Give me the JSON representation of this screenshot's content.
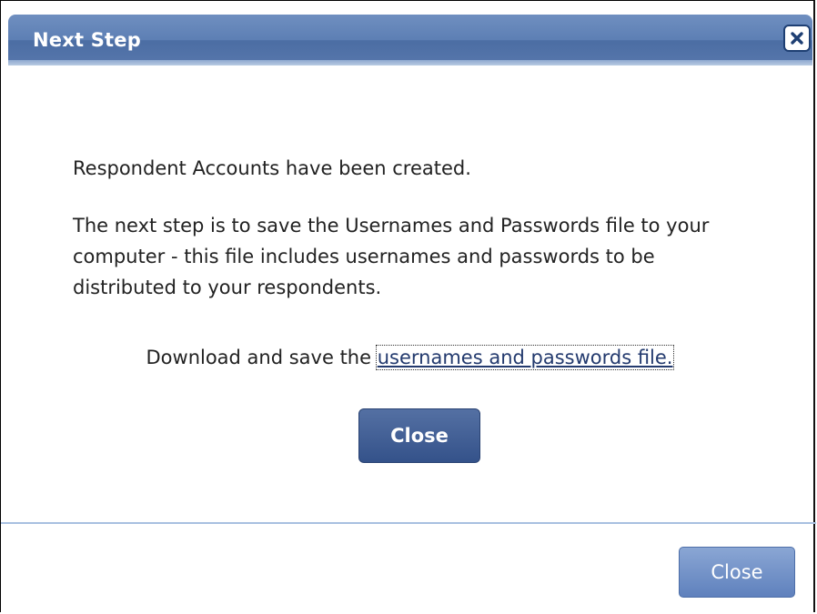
{
  "dialog": {
    "title": "Next Step",
    "close_icon": "close-x-icon"
  },
  "body": {
    "line1": "Respondent Accounts have been created.",
    "line2": "The next step is to save the Usernames and Passwords file to your computer - this file includes usernames and passwords to be distributed to your respondents.",
    "download_prefix": "Download and save the ",
    "download_link": "usernames and passwords file.",
    "close_button": "Close"
  },
  "footer": {
    "close_button": "Close"
  },
  "colors": {
    "titlebar": "#5d7fb4",
    "primary_button": "#3f5c93",
    "footer_button": "#7596cb",
    "divider": "#a8c0e0"
  }
}
